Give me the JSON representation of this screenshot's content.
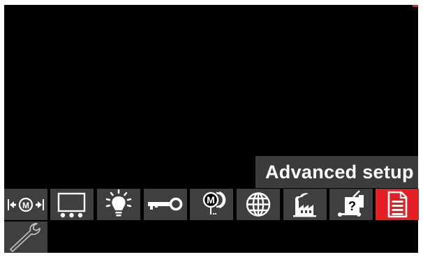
{
  "tooltip": {
    "text": "Advanced setup"
  },
  "colors": {
    "background": "#000000",
    "button": "#3f3f3f",
    "active": "#e41f25",
    "tooltip": "#3c3c3c",
    "icon": "#ffffff"
  },
  "toolbar": {
    "selected_index": 8,
    "items": [
      {
        "icon": "weld-mode-adjust-icon"
      },
      {
        "icon": "display-layout-icon"
      },
      {
        "icon": "brightness-icon"
      },
      {
        "icon": "lock-key-icon"
      },
      {
        "icon": "memory-icon"
      },
      {
        "icon": "language-globe-icon"
      },
      {
        "icon": "factory-reset-icon"
      },
      {
        "icon": "machine-info-icon"
      },
      {
        "icon": "advanced-setup-icon"
      }
    ],
    "second_row": [
      {
        "icon": "wrench-icon"
      }
    ]
  }
}
